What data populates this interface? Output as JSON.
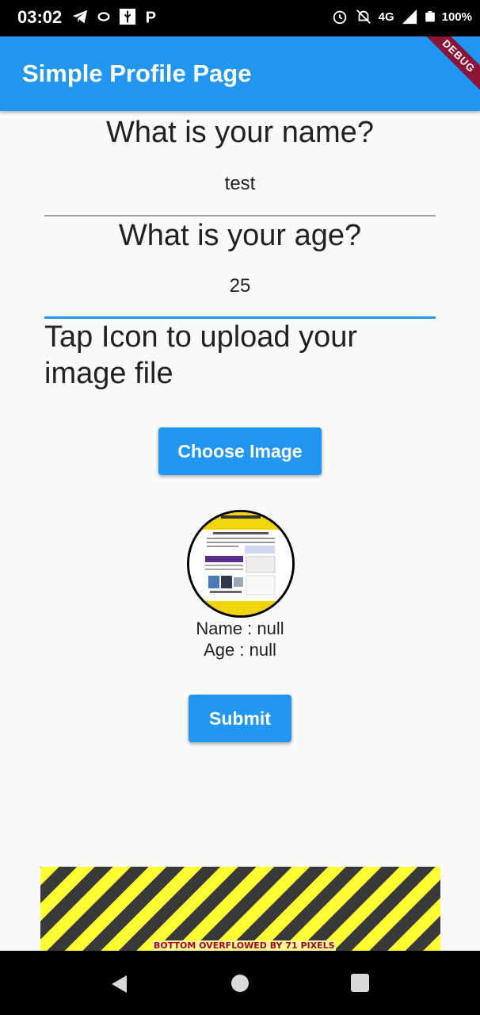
{
  "status_bar": {
    "time": "03:02",
    "network": "4G",
    "battery": "100%"
  },
  "app_bar": {
    "title": "Simple Profile Page",
    "debug_banner": "DEBUG"
  },
  "form": {
    "name_question": "What is your name?",
    "name_value": "test",
    "age_question": "What is your age?",
    "age_value": "25",
    "upload_instruction": "Tap Icon to upload your image file",
    "choose_image_label": "Choose Image",
    "name_display": "Name : null",
    "age_display": "Age : null",
    "submit_label": "Submit"
  },
  "overflow_warning": "BOTTOM OVERFLOWED BY 71 PIXELS",
  "colors": {
    "primary": "#2196f3",
    "focused_underline": "#2196f3",
    "unfocused_underline": "#9e9e9e",
    "hazard_yellow": "#ffff33",
    "hazard_dark": "#3a3a3a"
  },
  "icons": {
    "status_left": [
      "telegram-icon",
      "sync-icon",
      "usb-icon",
      "parking-icon"
    ],
    "status_right": [
      "alarm-icon",
      "notifications-off-icon",
      "signal-icon",
      "battery-icon"
    ],
    "nav": [
      "back-icon",
      "home-icon",
      "recents-icon"
    ]
  }
}
